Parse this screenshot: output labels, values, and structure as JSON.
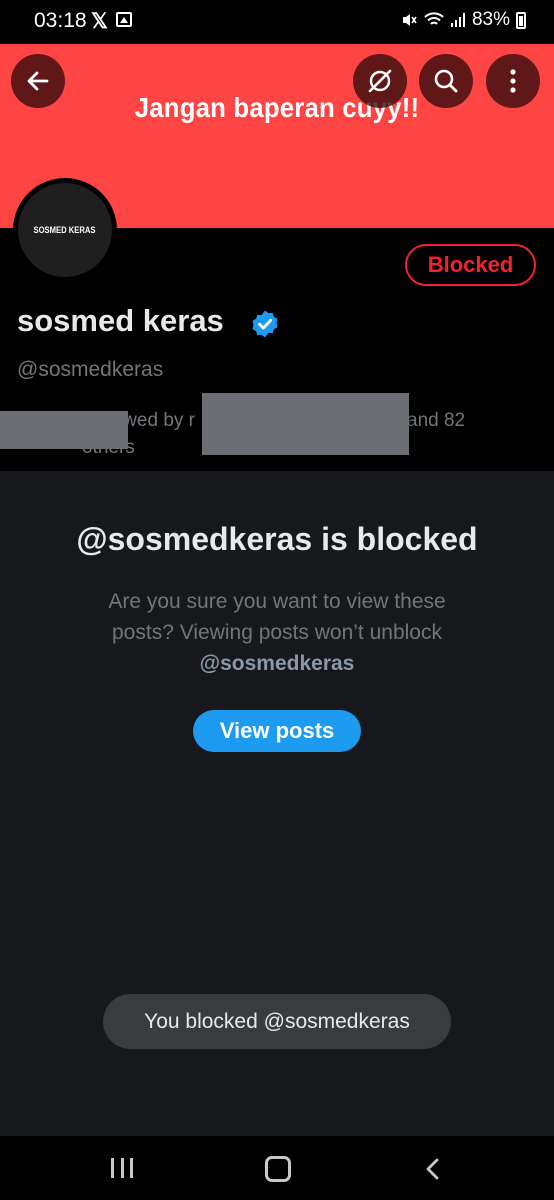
{
  "status_bar": {
    "time": "03:18",
    "battery": "83%",
    "icons": [
      "x-app-icon",
      "gallery-icon",
      "mute-icon",
      "wifi-icon",
      "signal-icon",
      "battery-icon"
    ]
  },
  "banner": {
    "text": "Jangan baperan cuyy!!",
    "color": "#ff4444",
    "buttons": [
      "back-arrow-icon",
      "grok-icon",
      "search-icon",
      "more-vertical-icon"
    ]
  },
  "profile": {
    "avatar_text": "SOSMED KERAS",
    "display_name": "sosmed keras",
    "handle": "@sosmedkeras",
    "followed_by_prefix": "Followed by r",
    "followed_by_suffix": "and 82",
    "followed_by_others": "others",
    "blocked_label": "Blocked",
    "verified_color": "#1d9bf0"
  },
  "blocked_notice": {
    "title": "@sosmedkeras is blocked",
    "description": "Are you sure you want to view these posts? Viewing posts won’t unblock",
    "handle": "@sosmedkeras",
    "view_button": "View posts"
  },
  "toast": {
    "text": "You blocked @sosmedkeras"
  },
  "colors": {
    "accent": "#1d9bf0",
    "danger": "#f4212e",
    "background": "#16181c"
  }
}
